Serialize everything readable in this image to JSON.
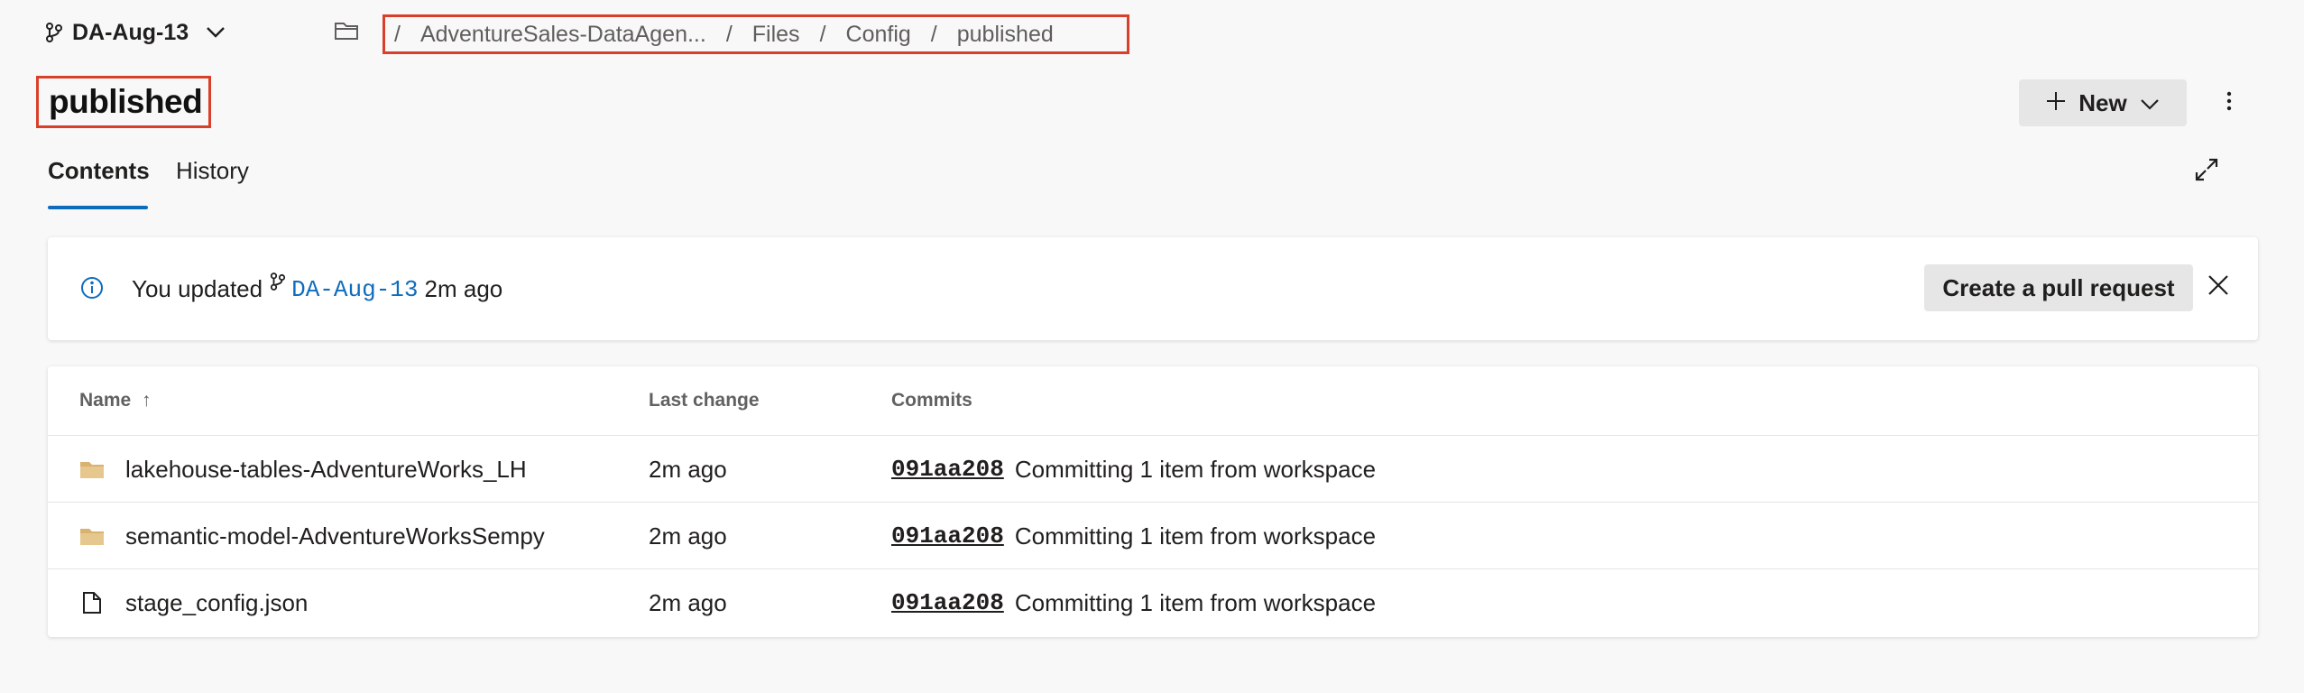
{
  "header": {
    "branch_name": "DA-Aug-13",
    "breadcrumb": [
      "AdventureSales-DataAgen...",
      "Files",
      "Config",
      "published"
    ]
  },
  "page": {
    "title": "published",
    "new_button_label": "New"
  },
  "tabs": [
    "Contents",
    "History"
  ],
  "banner": {
    "prefix": "You updated",
    "branch": "DA-Aug-13",
    "suffix": "2m ago",
    "action_label": "Create a pull request"
  },
  "table": {
    "columns": [
      "Name",
      "Last change",
      "Commits"
    ],
    "sort_indicator": "↑",
    "rows": [
      {
        "icon": "folder-icon",
        "name": "lakehouse-tables-AdventureWorks_LH",
        "last_change": "2m ago",
        "commit_hash": "091aa208",
        "commit_message": "Committing 1 item from workspace"
      },
      {
        "icon": "folder-icon",
        "name": "semantic-model-AdventureWorksSempy",
        "last_change": "2m ago",
        "commit_hash": "091aa208",
        "commit_message": "Committing 1 item from workspace"
      },
      {
        "icon": "file-icon",
        "name": "stage_config.json",
        "last_change": "2m ago",
        "commit_hash": "091aa208",
        "commit_message": "Committing 1 item from workspace"
      }
    ]
  },
  "colors": {
    "accent": "#0f6cbd",
    "highlight_border": "#d9402b",
    "folder": "#d8b26e"
  }
}
